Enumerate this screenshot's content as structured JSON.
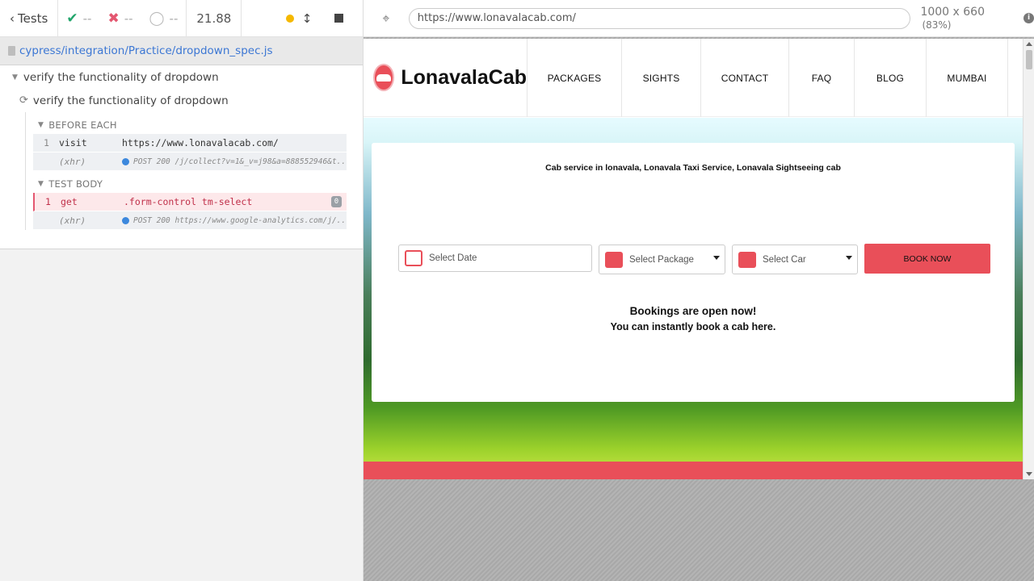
{
  "reporter": {
    "tests_label": "Tests",
    "passed": "--",
    "failed": "--",
    "pending": "--",
    "duration": "21.88",
    "spec_path": "cypress/integration/Practice/dropdown_spec.js",
    "suite_title": "verify the functionality of dropdown",
    "test_title": "verify the functionality of dropdown",
    "hooks": [
      {
        "title": "BEFORE EACH",
        "commands": [
          {
            "num": "1",
            "name": "visit",
            "message": "https://www.lonavalacab.com/"
          },
          {
            "num": "",
            "name": "(xhr)",
            "message": "POST 200 /j/collect?v=1&_v=j98&a=888552946&t..."
          }
        ]
      },
      {
        "title": "TEST BODY",
        "commands": [
          {
            "num": "1",
            "name": "get",
            "message": ".form-control tm-select",
            "badge": "0"
          },
          {
            "num": "",
            "name": "(xhr)",
            "message": "POST 200 https://www.google-analytics.com/j/..."
          }
        ]
      }
    ]
  },
  "aut": {
    "url": "https://www.lonavalacab.com/",
    "viewport": "1000 x 660",
    "scale": "(83%)",
    "site": {
      "logo_text": "LonavalaCab",
      "nav": [
        "PACKAGES",
        "SIGHTS",
        "CONTACT",
        "FAQ",
        "BLOG",
        "MUMBAI"
      ],
      "tagline": "Cab service in lonavala, Lonavala Taxi Service, Lonavala Sightseeing cab",
      "date_placeholder": "Select Date",
      "package_select": "Select Package",
      "car_select": "Select Car",
      "book_button": "BOOK NOW",
      "open_heading": "Bookings are open now!",
      "open_sub": "You can instantly book a cab here."
    }
  },
  "colors": {
    "accent": "#e94f59",
    "pass": "#21a56b",
    "fail": "#e45770",
    "link": "#3c77d4"
  }
}
